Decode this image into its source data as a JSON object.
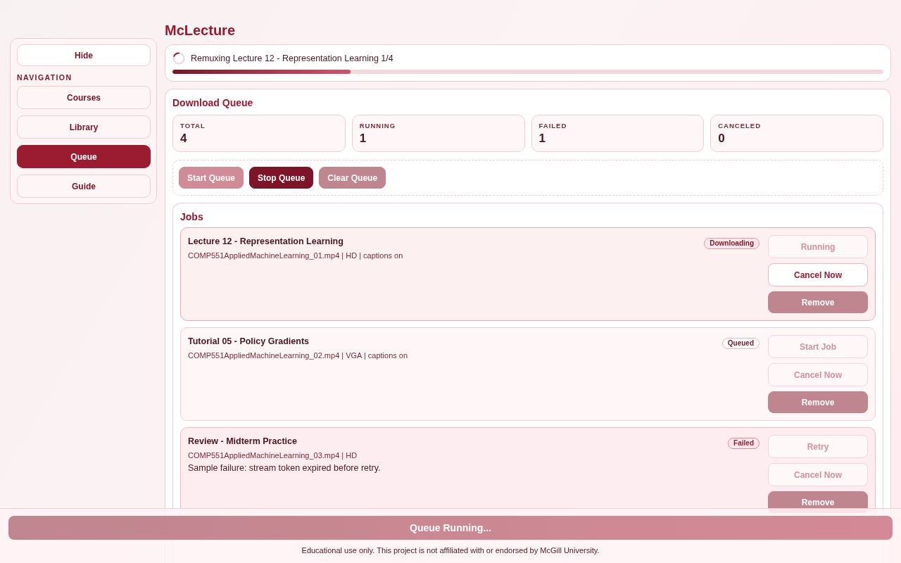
{
  "app": {
    "title": "McLecture"
  },
  "sidebar": {
    "hide_button": "Hide",
    "section_label": "NAVIGATION",
    "items": [
      {
        "label": "Courses",
        "selected": false
      },
      {
        "label": "Library",
        "selected": false
      },
      {
        "label": "Queue",
        "selected": true
      },
      {
        "label": "Guide",
        "selected": false
      }
    ]
  },
  "progress": {
    "message": "Remuxing Lecture 12 - Representation Learning 1/4",
    "level": 0.25
  },
  "queue": {
    "title": "Download Queue",
    "stats": [
      {
        "label": "TOTAL",
        "value": "4"
      },
      {
        "label": "RUNNING",
        "value": "1"
      },
      {
        "label": "FAILED",
        "value": "1"
      },
      {
        "label": "CANCELED",
        "value": "0"
      }
    ],
    "controls": [
      {
        "label": "Start Queue",
        "kind": "primary",
        "disabled": true
      },
      {
        "label": "Stop Queue",
        "kind": "danger",
        "disabled": false
      },
      {
        "label": "Clear Queue",
        "kind": "danger",
        "disabled": true
      }
    ]
  },
  "jobs": {
    "title": "Jobs",
    "items": [
      {
        "kind": "downloading",
        "title": "Lecture 12 - Representation Learning",
        "file": "COMP551AppliedMachineLearning_01.mp4 | HD | captions on",
        "status": "Downloading",
        "actions": [
          {
            "label": "Running",
            "kind": "outline",
            "disabled": true
          },
          {
            "label": "Cancel Now",
            "kind": "outline",
            "disabled": false
          },
          {
            "label": "Remove",
            "kind": "danger",
            "disabled": true
          }
        ]
      },
      {
        "kind": "queued",
        "title": "Tutorial 05 - Policy Gradients",
        "file": "COMP551AppliedMachineLearning_02.mp4 | VGA | captions on",
        "status": "Queued",
        "actions": [
          {
            "label": "Start Job",
            "kind": "outline",
            "disabled": true
          },
          {
            "label": "Cancel Now",
            "kind": "outline",
            "disabled": true
          },
          {
            "label": "Remove",
            "kind": "danger",
            "disabled": true
          }
        ]
      },
      {
        "kind": "failed",
        "title": "Review - Midterm Practice",
        "file": "COMP551AppliedMachineLearning_03.mp4 | HD",
        "error": "Sample failure: stream token expired before retry.",
        "status": "Failed",
        "actions": [
          {
            "label": "Retry",
            "kind": "outline",
            "disabled": true
          },
          {
            "label": "Cancel Now",
            "kind": "outline",
            "disabled": true
          },
          {
            "label": "Remove",
            "kind": "danger",
            "disabled": true
          }
        ]
      }
    ]
  },
  "footer": {
    "status_button": {
      "label": "Queue Running...",
      "disabled": true
    },
    "note": "Educational use only. This project is not affiliated with or endorsed by McGill University."
  }
}
